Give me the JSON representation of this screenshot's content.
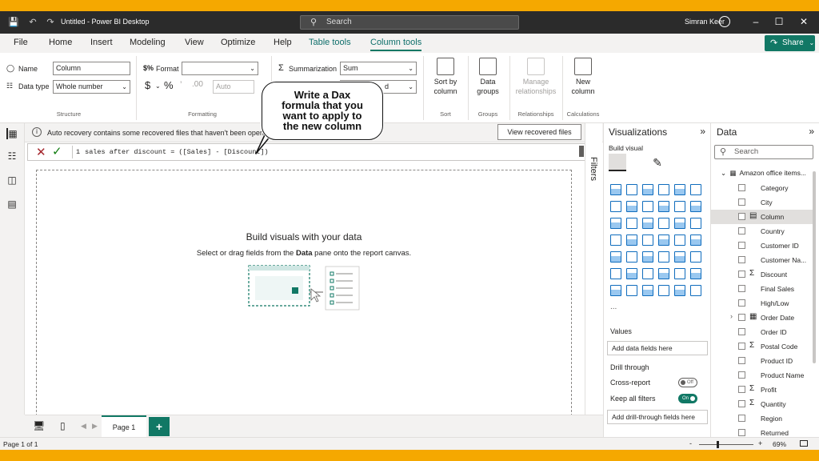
{
  "titlebar": {
    "title": "Untitled - Power BI Desktop",
    "search_placeholder": "Search",
    "user": "Simran Keer"
  },
  "menu": {
    "items": [
      "File",
      "Home",
      "Insert",
      "Modeling",
      "View",
      "Optimize",
      "Help"
    ],
    "context_tabs": [
      "Table tools",
      "Column tools"
    ],
    "share": "Share"
  },
  "ribbon": {
    "name_label": "Name",
    "name_value": "Column",
    "datatype_label": "Data type",
    "datatype_value": "Whole number",
    "structure_group": "Structure",
    "format_label": "Format",
    "format_value": "",
    "currency": "$",
    "percent": "%",
    "decimal": "Auto",
    "formatting_group": "Formatting",
    "summarization_label": "Summarization",
    "summarization_value": "Sum",
    "properties_partial": "d",
    "sort_btn": [
      "Sort by",
      "column"
    ],
    "sort_group": "Sort",
    "data_groups_btn": [
      "Data",
      "groups"
    ],
    "groups_group": "Groups",
    "manage_rel_btn": [
      "Manage",
      "relationships"
    ],
    "relationships_group": "Relationships",
    "new_column_btn": [
      "New",
      "column"
    ],
    "calculations_group": "Calculations"
  },
  "infobar": {
    "message": "Auto recovery contains some recovered files that haven't been opene",
    "button": "View recovered files"
  },
  "formula": {
    "line_no": "1",
    "text": "sales after discount = ([Sales] - [Discount])"
  },
  "canvas": {
    "title": "Build visuals with your data",
    "subtitle_pre": "Select or drag fields from the ",
    "subtitle_bold": "Data",
    "subtitle_post": " pane onto the report canvas."
  },
  "filters_label": "Filters",
  "visualizations": {
    "title": "Visualizations",
    "build_visual": "Build visual",
    "more": "...",
    "values_label": "Values",
    "values_drop": "Add data fields here",
    "drill_label": "Drill through",
    "cross_report": "Cross-report",
    "cross_report_state": "Off",
    "keep_filters": "Keep all filters",
    "keep_filters_state": "On",
    "drill_drop": "Add drill-through fields here"
  },
  "data_pane": {
    "title": "Data",
    "search_placeholder": "Search",
    "table_name": "Amazon office items...",
    "fields": [
      {
        "name": "Category",
        "sigma": false
      },
      {
        "name": "City",
        "sigma": false
      },
      {
        "name": "Column",
        "sigma": false,
        "selected": true,
        "icon": "calc-column-icon"
      },
      {
        "name": "Country",
        "sigma": false
      },
      {
        "name": "Customer ID",
        "sigma": false
      },
      {
        "name": "Customer Na...",
        "sigma": false
      },
      {
        "name": "Discount",
        "sigma": true
      },
      {
        "name": "Final Sales",
        "sigma": false
      },
      {
        "name": "High/Low",
        "sigma": false
      },
      {
        "name": "Order Date",
        "sigma": false,
        "icon": "calendar-icon",
        "expandable": true
      },
      {
        "name": "Order ID",
        "sigma": false
      },
      {
        "name": "Postal Code",
        "sigma": true
      },
      {
        "name": "Product ID",
        "sigma": false
      },
      {
        "name": "Product Name",
        "sigma": false
      },
      {
        "name": "Profit",
        "sigma": true
      },
      {
        "name": "Quantity",
        "sigma": true
      },
      {
        "name": "Region",
        "sigma": false
      },
      {
        "name": "Returned",
        "sigma": false
      }
    ]
  },
  "pages": {
    "tab": "Page 1",
    "add": "+"
  },
  "status": {
    "page": "Page 1 of 1",
    "zoom_minus": "-",
    "zoom_plus": "+",
    "zoom": "69%"
  },
  "callout": {
    "lines": [
      "Write a Dax",
      "formula that you",
      "want to apply to",
      "the new column"
    ]
  },
  "colors": {
    "accent": "#117865",
    "frame": "#f5a800",
    "titlebar": "#2b2b2b"
  }
}
